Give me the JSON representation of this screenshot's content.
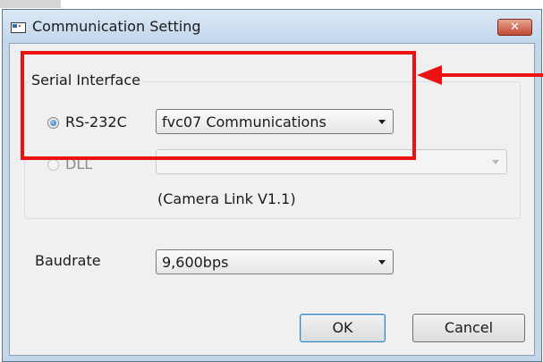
{
  "window": {
    "title": "Communication Setting",
    "close_label": "✕"
  },
  "serial_interface": {
    "legend": "Serial Interface",
    "rs232c": {
      "label": "RS-232C",
      "checked": true,
      "selected": "fvc07 Communications"
    },
    "dll": {
      "label": "DLL",
      "checked": false,
      "selected": "",
      "note": "(Camera Link V1.1)"
    }
  },
  "baudrate": {
    "label": "Baudrate",
    "selected": "9,600bps"
  },
  "buttons": {
    "ok": "OK",
    "cancel": "Cancel"
  },
  "colors": {
    "annotation": "#ee1111",
    "title_bar": "#c3d6ea",
    "close_button": "#c04a33"
  }
}
